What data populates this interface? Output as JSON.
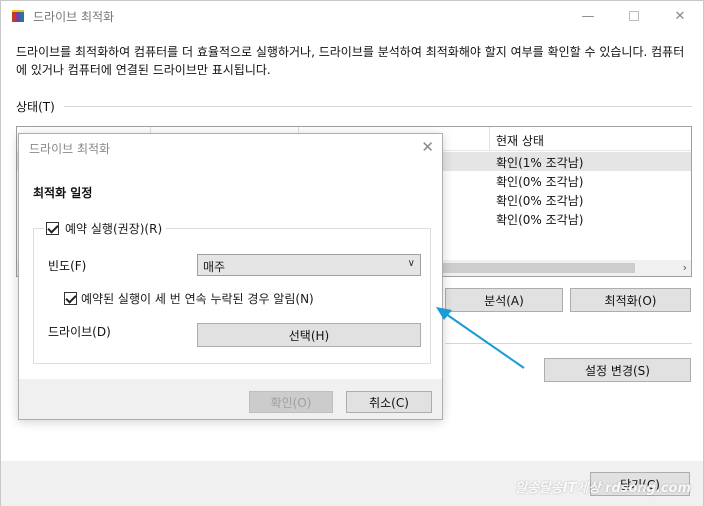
{
  "main": {
    "title": "드라이브 최적화",
    "description": "드라이브를 최적화하여 컴퓨터를 더 효율적으로 실행하거나, 드라이브를 분석하여 최적화해야 할지 여부를 확인할 수 있습니다. 컴퓨터에 있거나 컴퓨터에 연결된 드라이브만 표시됩니다.",
    "status_label": "상태(T)",
    "list": {
      "status_header": "현재 상태",
      "rows": [
        "확인(1% 조각남)",
        "확인(0% 조각남)",
        "확인(0% 조각남)",
        "확인(0% 조각남)"
      ]
    },
    "analyze_label": "분석(A)",
    "optimize_label": "최적화(O)",
    "change_settings_label": "설정 변경(S)",
    "close_label": "닫기(C)",
    "watermark": "알송달송IT세상 rdsong.com"
  },
  "dialog": {
    "title": "드라이브 최적화",
    "heading": "최적화 일정",
    "scheduled_run_label": "예약 실행(권장)(R)",
    "frequency_label": "빈도(F)",
    "frequency_value": "매주",
    "notify_label": "예약된 실행이 세 번 연속 누락된 경우 알림(N)",
    "drives_label": "드라이브(D)",
    "choose_label": "선택(H)",
    "ok_label": "확인(O)",
    "cancel_label": "취소(C)"
  },
  "colors": {
    "accent": "#1a9bd7",
    "button_face": "#e1e1e1",
    "footer_bg": "#f0f0f0"
  },
  "icons": {
    "app": "defrag-app-icon",
    "minimize": "minimize-icon",
    "maximize": "maximize-icon",
    "close": "close-icon"
  }
}
